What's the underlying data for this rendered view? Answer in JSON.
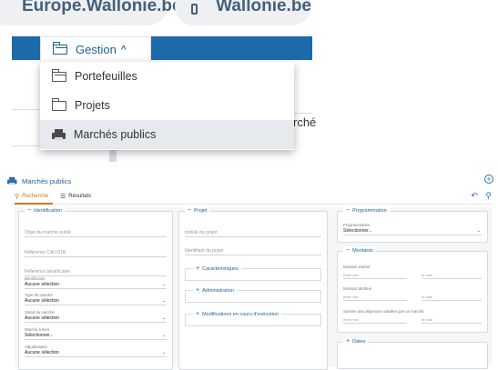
{
  "background": {
    "tile1": "Europe.Wallonie.be",
    "tile2": "Wallonie.be",
    "behind_text": "rché"
  },
  "menu": {
    "trigger_label": "Gestion",
    "items": [
      {
        "label": "Portefeuilles",
        "icon": "folders-icon",
        "active": false
      },
      {
        "label": "Projets",
        "icon": "folder-icon",
        "active": false
      },
      {
        "label": "Marchés publics",
        "icon": "printer-icon",
        "active": true
      }
    ]
  },
  "app": {
    "title": "Marchés publics",
    "tabs": [
      {
        "label": "Recherche",
        "active": true,
        "icon": "search-icon"
      },
      {
        "label": "Résultats",
        "active": false,
        "icon": "list-icon"
      }
    ]
  },
  "identification": {
    "legend": "Identification",
    "objet_placeholder": "Objet du marché public",
    "calista_placeholder": "Référence CALISTA",
    "ref_benef_placeholder": "Référence bénéficiaire",
    "beneficiaire_label": "Bénéficiaire",
    "beneficiaire_value": "Aucune sélection",
    "type_label": "Type du marché",
    "type_value": "Aucune sélection",
    "statut_label": "Statut du marché",
    "statut_value": "Aucune sélection",
    "marche_label": "Marché à tiers",
    "marche_value": "Sélectionner...",
    "adjudicataire_label": "Adjudicataire",
    "adjudicataire_value": "Aucune sélection"
  },
  "projet": {
    "legend": "Projet",
    "intitule_placeholder": "Intitulé du projet",
    "identifiant_placeholder": "Identifiant du projet",
    "sections": [
      "Caractéristiques",
      "Administration",
      "Modifications en cours d'exécution"
    ]
  },
  "programmation": {
    "legend": "Programmation",
    "label": "Programmation",
    "value": "Sélectionner..."
  },
  "montants": {
    "legend": "Montants",
    "rows": [
      {
        "label": "Montant estimé",
        "from": "entre min",
        "to": "et max"
      },
      {
        "label": "Montant attribué",
        "from": "entre min",
        "to": "et max"
      },
      {
        "label": "Somme des dépenses validées par un marché",
        "from": "entre min",
        "to": "et max"
      }
    ]
  },
  "dates": {
    "legend": "Dates"
  }
}
